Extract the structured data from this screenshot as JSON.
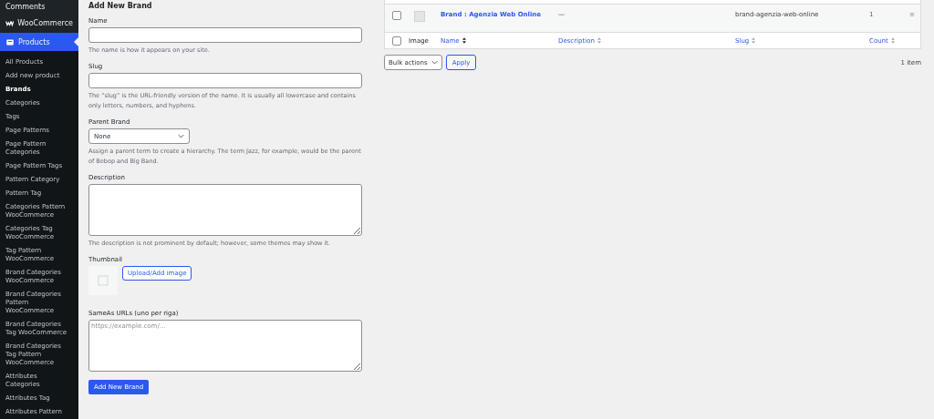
{
  "sidebar": {
    "top_items": [
      {
        "label": "Comments",
        "kind": "plain",
        "selected": false
      },
      {
        "label": "WooCommerce",
        "kind": "woo",
        "selected": false
      },
      {
        "label": "Products",
        "kind": "folder",
        "selected": true
      }
    ],
    "sub_items": [
      {
        "label": "All Products",
        "selected": false
      },
      {
        "label": "Add new product",
        "selected": false
      },
      {
        "label": "Brands",
        "selected": true
      },
      {
        "label": "Categories",
        "selected": false
      },
      {
        "label": "Tags",
        "selected": false
      },
      {
        "label": "Page Patterns",
        "selected": false
      },
      {
        "label": "Page Pattern Categories",
        "selected": false
      },
      {
        "label": "Page Pattern Tags",
        "selected": false
      },
      {
        "label": "Pattern Category",
        "selected": false
      },
      {
        "label": "Pattern Tag",
        "selected": false
      },
      {
        "label": "Categories Pattern WooCommerce",
        "selected": false
      },
      {
        "label": "Categories Tag WooCommerce",
        "selected": false
      },
      {
        "label": "Tag Pattern WooCommerce",
        "selected": false
      },
      {
        "label": "Brand Categories WooCommerce",
        "selected": false
      },
      {
        "label": "Brand Categories Pattern WooCommerce",
        "selected": false
      },
      {
        "label": "Brand Categories Tag WooCommerce",
        "selected": false
      },
      {
        "label": "Brand Categories Tag Pattern WooCommerce",
        "selected": false
      },
      {
        "label": "Attributes Categories",
        "selected": false
      },
      {
        "label": "Attributes Tag",
        "selected": false
      },
      {
        "label": "Attributes Pattern",
        "selected": false
      }
    ]
  },
  "form": {
    "title": "Add New Brand",
    "name": {
      "label": "Name",
      "help": "The name is how it appears on your site."
    },
    "slug": {
      "label": "Slug",
      "help": "The “slug” is the URL-friendly version of the name. It is usually all lowercase and contains only letters, numbers, and hyphens."
    },
    "parent": {
      "label": "Parent Brand",
      "value": "None",
      "help": "Assign a parent term to create a hierarchy. The term Jazz, for example, would be the parent of Bebop and Big Band."
    },
    "description": {
      "label": "Description",
      "help": "The description is not prominent by default; however, some themes may show it."
    },
    "thumbnail": {
      "label": "Thumbnail",
      "button": "Upload/Add image"
    },
    "sameas": {
      "label": "SameAs URLs (uno per riga)",
      "placeholder": "https://example.com/..."
    },
    "submit": "Add New Brand"
  },
  "table": {
    "select_all_checked": false,
    "columns": [
      {
        "label": "Image",
        "kind": "plain"
      },
      {
        "label": "Name",
        "kind": "sorted"
      },
      {
        "label": "Description",
        "kind": "sortable"
      },
      {
        "label": "Slug",
        "kind": "sortable"
      },
      {
        "label": "Count",
        "kind": "sortable"
      }
    ],
    "rows": [
      {
        "name": "Brand : Agenzia Web Online",
        "description": "—",
        "slug": "brand-agenzia-web-online",
        "count": "1",
        "handle": "≡",
        "checked": false
      }
    ],
    "bulk_actions": "Bulk actions",
    "apply": "Apply",
    "item_count": "1 item"
  }
}
